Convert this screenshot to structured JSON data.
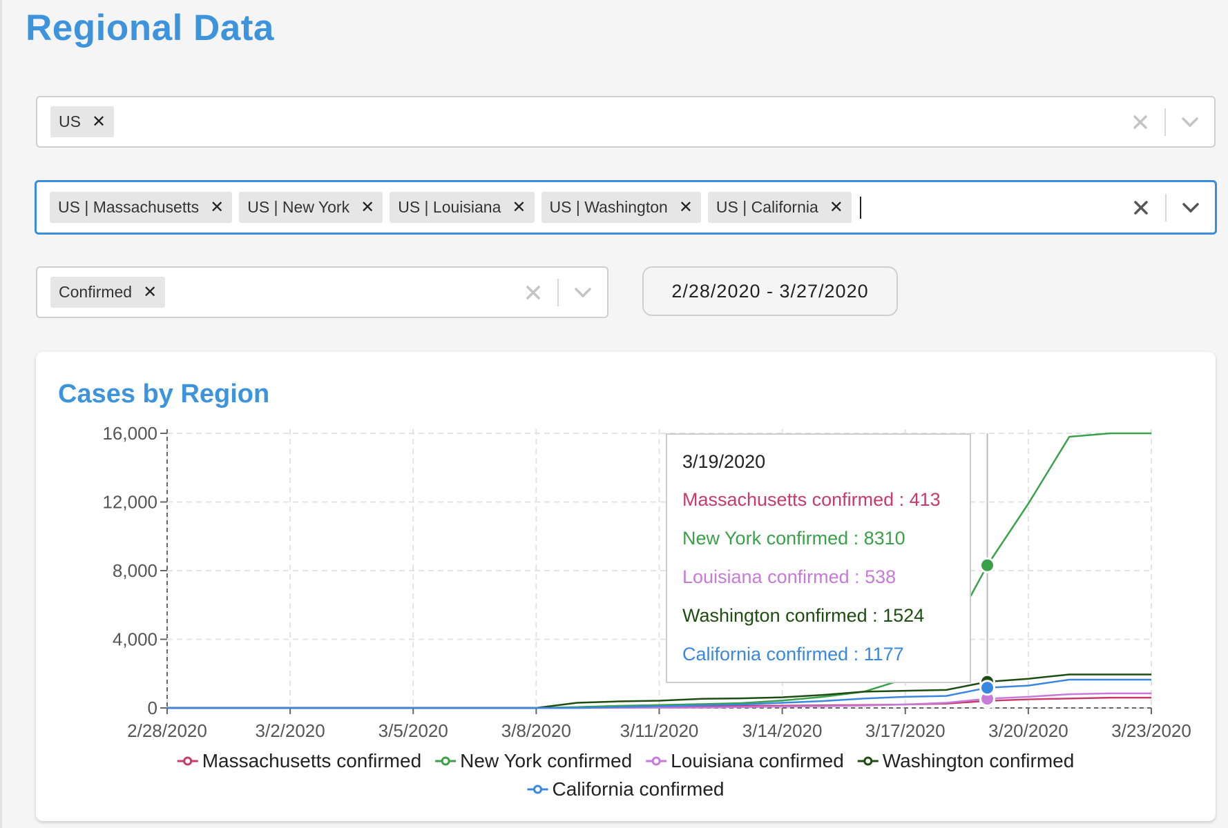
{
  "page": {
    "title": "Regional Data"
  },
  "country_select": {
    "chips": [
      "US"
    ]
  },
  "region_select": {
    "chips": [
      "US | Massachusetts",
      "US | New York",
      "US | Louisiana",
      "US | Washington",
      "US | California"
    ]
  },
  "metric_select": {
    "chips": [
      "Confirmed"
    ]
  },
  "date_range": {
    "label": "2/28/2020 - 3/27/2020"
  },
  "chart_card": {
    "title": "Cases by Region"
  },
  "colors": {
    "accent": "#3d94dc",
    "massachusetts": "#c93a6b",
    "new_york": "#3aa04a",
    "louisiana": "#c77ad8",
    "washington": "#1d4d10",
    "california": "#3a87e0"
  },
  "tooltip": {
    "date": "3/19/2020",
    "rows": [
      {
        "label": "Massachusetts confirmed : 413",
        "color": "#c93a6b"
      },
      {
        "label": "New York confirmed : 8310",
        "color": "#3aa04a"
      },
      {
        "label": "Louisiana confirmed : 538",
        "color": "#c77ad8"
      },
      {
        "label": "Washington confirmed : 1524",
        "color": "#1d4d10"
      },
      {
        "label": "California confirmed : 1177",
        "color": "#3a87e0"
      }
    ]
  },
  "chart_data": {
    "type": "line",
    "title": "Cases by Region",
    "xlabel": "",
    "ylabel": "",
    "x_tick_labels": [
      "2/28/2020",
      "3/2/2020",
      "3/5/2020",
      "3/8/2020",
      "3/11/2020",
      "3/14/2020",
      "3/17/2020",
      "3/20/2020",
      "3/23/2020"
    ],
    "x_tick_dates": [
      "2020-02-28",
      "2020-03-02",
      "2020-03-05",
      "2020-03-08",
      "2020-03-11",
      "2020-03-14",
      "2020-03-17",
      "2020-03-20",
      "2020-03-23"
    ],
    "y_tick_labels": [
      "0",
      "4,000",
      "8,000",
      "12,000",
      "16,000"
    ],
    "ylim": [
      0,
      16000
    ],
    "grid": true,
    "legend_position": "bottom",
    "highlight_date": "2020-03-19",
    "x": [
      "2020-02-28",
      "2020-02-29",
      "2020-03-01",
      "2020-03-02",
      "2020-03-03",
      "2020-03-04",
      "2020-03-05",
      "2020-03-06",
      "2020-03-07",
      "2020-03-08",
      "2020-03-09",
      "2020-03-10",
      "2020-03-11",
      "2020-03-12",
      "2020-03-13",
      "2020-03-14",
      "2020-03-15",
      "2020-03-16",
      "2020-03-17",
      "2020-03-18",
      "2020-03-19",
      "2020-03-20",
      "2020-03-21",
      "2020-03-22",
      "2020-03-23"
    ],
    "series": [
      {
        "name": "Massachusetts confirmed",
        "color": "#c93a6b",
        "values": [
          0,
          0,
          0,
          0,
          0,
          0,
          0,
          0,
          0,
          0,
          10,
          50,
          90,
          110,
          120,
          130,
          150,
          170,
          200,
          250,
          413,
          500,
          550,
          600,
          600
        ]
      },
      {
        "name": "New York confirmed",
        "color": "#3aa04a",
        "values": [
          0,
          0,
          0,
          0,
          0,
          0,
          0,
          0,
          0,
          0,
          50,
          120,
          170,
          220,
          280,
          430,
          650,
          950,
          1700,
          3900,
          8310,
          11900,
          15800,
          16000,
          16000
        ]
      },
      {
        "name": "Louisiana confirmed",
        "color": "#c77ad8",
        "values": [
          0,
          0,
          0,
          0,
          0,
          0,
          0,
          0,
          0,
          0,
          0,
          5,
          10,
          20,
          50,
          80,
          100,
          140,
          200,
          300,
          538,
          650,
          800,
          850,
          850
        ]
      },
      {
        "name": "Washington confirmed",
        "color": "#1d4d10",
        "values": [
          0,
          0,
          0,
          0,
          0,
          0,
          0,
          0,
          0,
          0,
          300,
          380,
          420,
          530,
          560,
          620,
          760,
          950,
          1000,
          1050,
          1524,
          1700,
          1950,
          1950,
          1950
        ]
      },
      {
        "name": "California confirmed",
        "color": "#3a87e0",
        "values": [
          0,
          0,
          0,
          0,
          0,
          0,
          0,
          0,
          0,
          0,
          0,
          50,
          100,
          150,
          200,
          300,
          400,
          550,
          650,
          700,
          1177,
          1300,
          1650,
          1650,
          1650
        ]
      }
    ]
  }
}
